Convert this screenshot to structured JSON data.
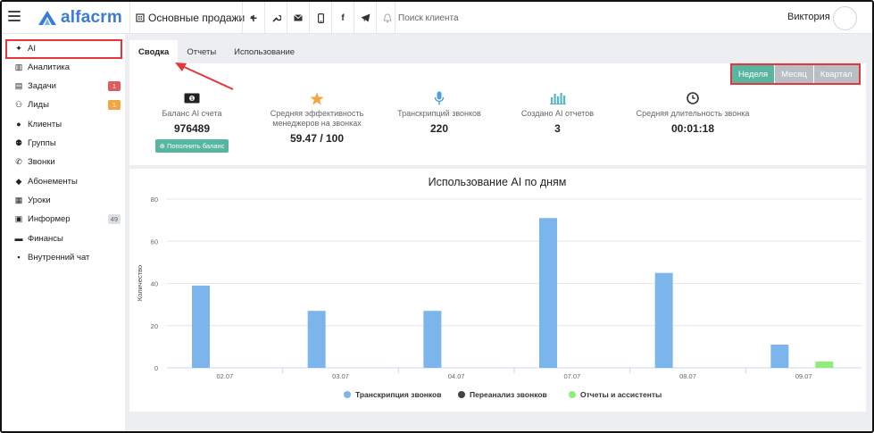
{
  "topbar": {
    "logo_text": "alfacrm",
    "branch": "Основные продажи",
    "search_placeholder": "Поиск клиента",
    "user_name": "Виктория",
    "icons": [
      "plus-icon",
      "wrench-icon",
      "mail-icon",
      "phone-icon",
      "facebook-icon",
      "telegram-icon",
      "bell-icon"
    ]
  },
  "sidebar": {
    "items": [
      {
        "label": "AI",
        "icon": "sparkle-icon",
        "badge": ""
      },
      {
        "label": "Аналитика",
        "icon": "map-icon",
        "badge": ""
      },
      {
        "label": "Задачи",
        "icon": "tasks-icon",
        "badge": "1"
      },
      {
        "label": "Лиды",
        "icon": "user-plus-icon",
        "badge": "1"
      },
      {
        "label": "Клиенты",
        "icon": "user-icon",
        "badge": ""
      },
      {
        "label": "Группы",
        "icon": "users-icon",
        "badge": ""
      },
      {
        "label": "Звонки",
        "icon": "phone-icon",
        "badge": ""
      },
      {
        "label": "Абонементы",
        "icon": "tag-icon",
        "badge": ""
      },
      {
        "label": "Уроки",
        "icon": "calendar-icon",
        "badge": ""
      },
      {
        "label": "Информер",
        "icon": "newspaper-icon",
        "badge": "49"
      },
      {
        "label": "Финансы",
        "icon": "money-icon",
        "badge": ""
      },
      {
        "label": "Внутренний чат",
        "icon": "chat-icon",
        "badge": ""
      }
    ]
  },
  "tabs": [
    "Сводка",
    "Отчеты",
    "Использование"
  ],
  "period": [
    "Неделя",
    "Месяц",
    "Квартал"
  ],
  "stats": [
    {
      "label": "Баланс AI счета",
      "value": "976489",
      "icon": "money-bill-icon",
      "action": "Пополнить баланс"
    },
    {
      "label": "Средняя эффективность менеджеров на звонках",
      "value": "59.47 / 100",
      "icon": "star-icon"
    },
    {
      "label": "Транскрипций звонков",
      "value": "220",
      "icon": "microphone-icon"
    },
    {
      "label": "Создано AI отчетов",
      "value": "3",
      "icon": "bar-chart-icon"
    },
    {
      "label": "Средняя длительность звонка",
      "value": "00:01:18",
      "icon": "clock-icon"
    }
  ],
  "colors": {
    "accent": "#58b6a0",
    "highlight": "#e3373b",
    "series_transcription": "#7cb5ec",
    "series_reanalysis": "#434348",
    "series_reports": "#90ed7d",
    "star": "#f2a541",
    "mic": "#4a9fe0",
    "bars_icon": "#58b6c8"
  },
  "chart_data": {
    "type": "bar",
    "title": "Использование AI по дням",
    "ylabel": "Количество",
    "xlabel": "",
    "ylim": [
      0,
      80
    ],
    "yticks": [
      0,
      20,
      40,
      60,
      80
    ],
    "categories": [
      "02.07",
      "03.07",
      "04.07",
      "07.07",
      "08.07",
      "09.07"
    ],
    "series": [
      {
        "name": "Транскрипция звонков",
        "values": [
          39,
          27,
          27,
          71,
          45,
          11
        ]
      },
      {
        "name": "Переанализ звонков",
        "values": [
          0,
          0,
          0,
          0,
          0,
          0
        ]
      },
      {
        "name": "Отчеты и ассистенты",
        "values": [
          0,
          0,
          0,
          0,
          0,
          3
        ]
      }
    ],
    "legend": "bottom",
    "grid": true
  }
}
